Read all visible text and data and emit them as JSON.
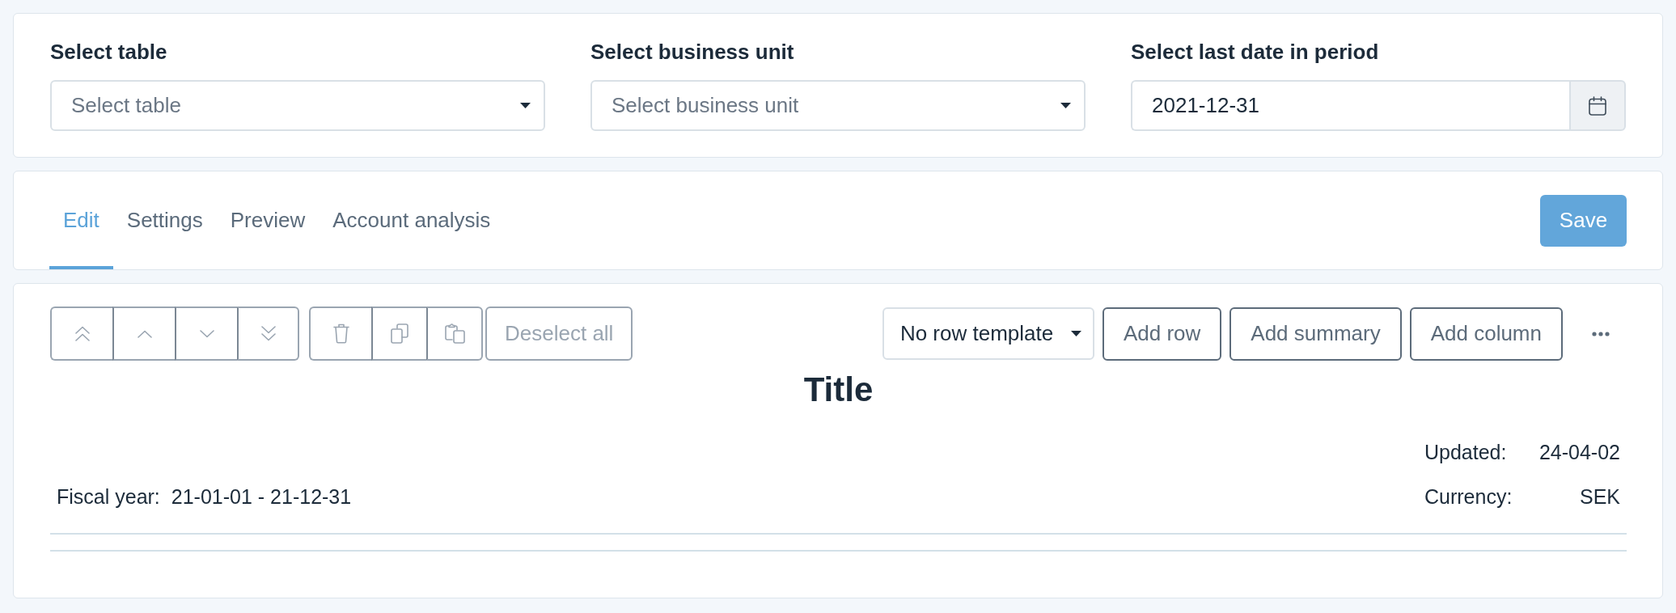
{
  "filters": [
    {
      "kind": "select",
      "label": "Select table",
      "placeholder": "Select table"
    },
    {
      "kind": "select",
      "label": "Select business unit",
      "placeholder": "Select business unit"
    },
    {
      "kind": "date",
      "label": "Select last date in period",
      "value": "2021-12-31"
    }
  ],
  "tabs": [
    {
      "label": "Edit",
      "selected": true
    },
    {
      "label": "Settings",
      "selected": false
    },
    {
      "label": "Preview",
      "selected": false
    },
    {
      "label": "Account analysis",
      "selected": false
    }
  ],
  "save_button": {
    "label": "Save"
  },
  "toolbar": {
    "button_groups": [
      [
        {
          "kind": "move_to_top",
          "disabled": true
        },
        {
          "kind": "move_up",
          "disabled": true
        },
        {
          "kind": "move_down",
          "disabled": true
        },
        {
          "kind": "move_to_bottom",
          "disabled": true
        }
      ],
      [
        {
          "kind": "delete",
          "disabled": true
        },
        {
          "kind": "copy",
          "disabled": true
        },
        {
          "kind": "paste",
          "disabled": true
        }
      ]
    ],
    "deselect_button": {
      "label": "Deselect all",
      "disabled": true
    },
    "row_template": {
      "value": "No row template"
    },
    "actions": [
      "Add row",
      "Add summary",
      "Add column"
    ]
  },
  "report": {
    "title": "Title",
    "fiscal_year": {
      "label": "Fiscal year:",
      "value": "21-01-01 - 21-12-31"
    },
    "meta": [
      {
        "label": "Updated:",
        "value": "24-04-02"
      },
      {
        "label": "Currency:",
        "value": "SEK"
      }
    ]
  }
}
